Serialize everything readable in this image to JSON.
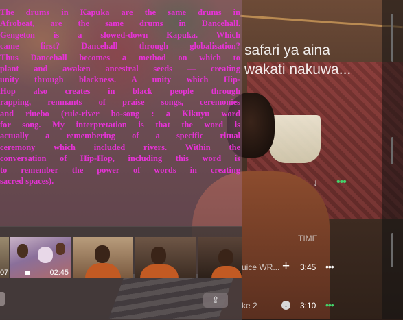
{
  "essay": {
    "lines": [
      "The drums in Kapuka are the same drums in",
      "Afrobeat, are the same drums in Dancehall.",
      "Gengeton is a slowed-down Kapuka. Which",
      "came first? Dancehall through globalisation?",
      "Thus Dancehall becomes a method on which to",
      "plant and awaken ancestral seeds — creating",
      "unity through blackness. A unity which Hip-",
      "Hop also creates in black people through",
      "rapping, remnants of praise songs, ceremonies",
      "and riuebo (ruie-river bo-song : a Kikuyu word",
      "for song. My interpretation is that the word is",
      "actually a remembering of a specific ritual",
      "ceremony which included rivers. Within the",
      "conversation of Hip-Hop, including this word is",
      "to remember the power of words in creating",
      "sacred spaces)."
    ],
    "color": "#e632d6"
  },
  "music_overlay": {
    "title_line1": "safari ya aina",
    "title_line2": "wakati nakuwa...",
    "time_header": "TIME",
    "rows": [
      {
        "title": "uice WR...",
        "duration": "3:45"
      },
      {
        "title": "ke 2",
        "duration": "3:10"
      }
    ],
    "accent_color": "#44d36a"
  },
  "photos": {
    "thumbnails": [
      {
        "label": "07"
      },
      {
        "label": "02:45"
      },
      {
        "label": ""
      },
      {
        "label": ""
      },
      {
        "label": ""
      }
    ],
    "share_icon": "share-icon"
  }
}
